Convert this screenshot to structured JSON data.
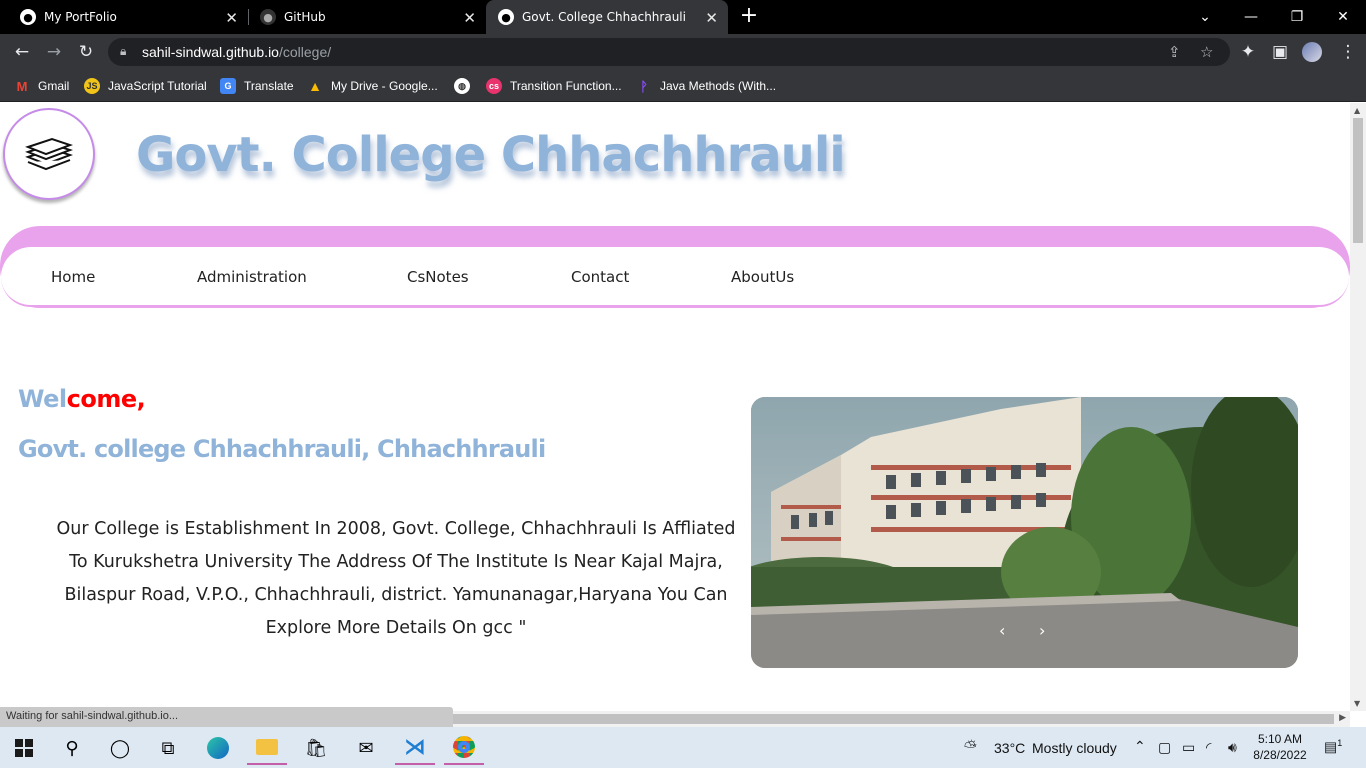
{
  "browser": {
    "tabs": [
      {
        "title": "My PortFolio",
        "icon": "github-icon",
        "active": false
      },
      {
        "title": "GitHub",
        "icon": "github-icon",
        "active": false
      },
      {
        "title": "Govt. College Chhachhrauli",
        "icon": "github-icon",
        "active": true
      }
    ],
    "url_host": "sahil-sindwal.github.io",
    "url_path": "/college/",
    "bookmarks": [
      {
        "label": "Gmail",
        "icon": "gmail-icon"
      },
      {
        "label": "JavaScript Tutorial",
        "icon": "js-icon"
      },
      {
        "label": "Translate",
        "icon": "translate-icon"
      },
      {
        "label": "My Drive - Google...",
        "icon": "drive-icon"
      },
      {
        "label": "",
        "icon": "globe-icon"
      },
      {
        "label": "Transition Function...",
        "icon": "cs-icon"
      },
      {
        "label": "Java Methods (With...",
        "icon": "programiz-icon"
      }
    ],
    "status_text": "Waiting for sahil-sindwal.github.io..."
  },
  "site": {
    "title": "Govt. College Chhachhrauli",
    "nav": [
      "Home",
      "Administration",
      "CsNotes",
      "Contact",
      "AboutUs"
    ],
    "welcome_part1": "Wel",
    "welcome_part2": "come,",
    "subheading": "Govt. college Chhachhrauli, Chhachhrauli",
    "about": "Our College is Establishment In 2008, Govt. College, Chhachhrauli Is Affliated To Kurukshetra University The Address Of The Institute Is Near Kajal Majra, Bilaspur Road, V.P.O., Chhachhrauli, district. Yamunanagar,Haryana You Can Explore More Details On gcc \"",
    "carousel_prev": "‹",
    "carousel_next": "›"
  },
  "taskbar": {
    "weather_temp": "33°C",
    "weather_desc": "Mostly cloudy",
    "time": "5:10 AM",
    "date": "8/28/2022",
    "notif_count": "1"
  },
  "colors": {
    "title_blue": "#8fb3d9",
    "nav_pink": "#e9a3ec",
    "welcome_red": "#ff0000"
  }
}
